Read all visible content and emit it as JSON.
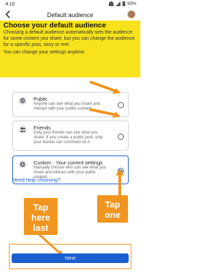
{
  "status_bar": {
    "time": "4:10",
    "battery": "93%"
  },
  "header": {
    "title": "Default audience"
  },
  "intro": {
    "title": "Choose your default audience",
    "body": "Choosing a default audience automatically sets the audience for some content you share, but you can change the audience for a specific post, story or reel.",
    "more": "You can change your settings anytime."
  },
  "options": [
    {
      "title": "Public",
      "description": "Anyone can see what you share and interact with your public content.",
      "icon": "globe-icon",
      "selected": false
    },
    {
      "title": "Friends",
      "description": "Only your friends can see what you share. If you create a public post, only your friends can comment on it.",
      "icon": "friends-icon",
      "selected": false
    },
    {
      "title": "Custom · Your current settings",
      "description": "Manually choose who can see what you share and interact with your public content.",
      "icon": "gear-icon",
      "selected": true
    }
  ],
  "help_link": "Need help choosing?",
  "annotations": {
    "tap_last": "Tap here last",
    "tap_one": "Tap one"
  },
  "next_button": "Next",
  "colors": {
    "highlight": "#f7e21c",
    "accent": "#1a5fd1",
    "annotation": "#f0951f"
  }
}
